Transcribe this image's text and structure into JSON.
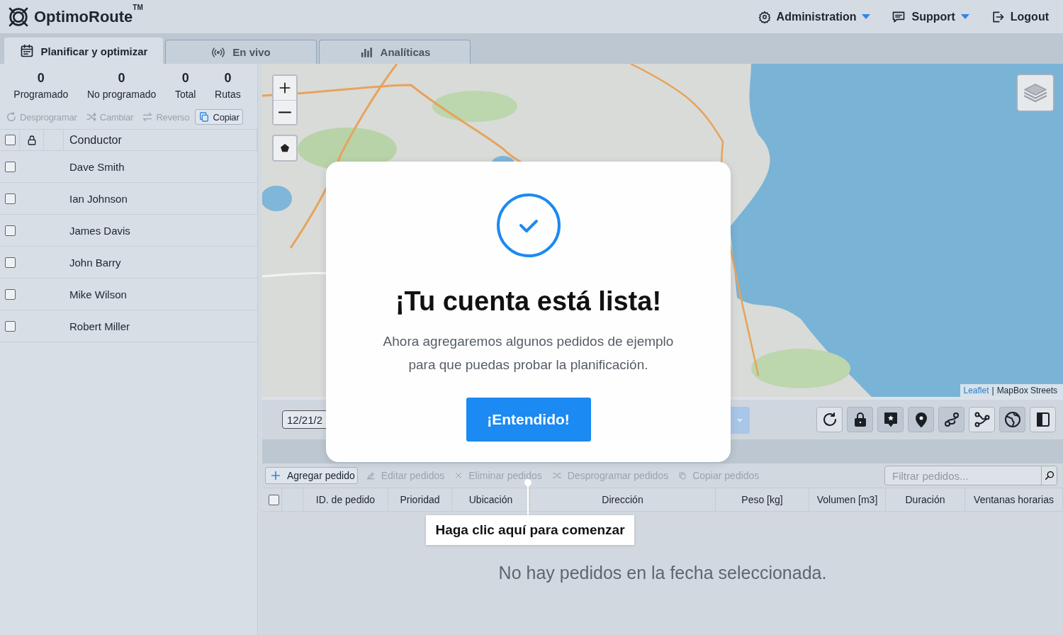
{
  "header": {
    "logo": "OptimoRoute",
    "trademark": "TM",
    "menu": [
      {
        "label": "Administration",
        "kind": "dropdown"
      },
      {
        "label": "Support",
        "kind": "dropdown"
      },
      {
        "label": "Logout",
        "kind": "link"
      }
    ]
  },
  "tabs": [
    {
      "label": "Planificar y optimizar",
      "selected": true
    },
    {
      "label": "En vivo",
      "selected": false
    },
    {
      "label": "Analíticas",
      "selected": false
    }
  ],
  "summary": [
    {
      "value": "0",
      "label": "Programado"
    },
    {
      "value": "0",
      "label": "No programado"
    },
    {
      "value": "0",
      "label": "Total"
    },
    {
      "value": "0",
      "label": "Rutas"
    }
  ],
  "route_actions": [
    {
      "label": "Desprogramar",
      "disabled": true
    },
    {
      "label": "Cambiar",
      "disabled": true
    },
    {
      "label": "Reverso",
      "disabled": true
    },
    {
      "label": "Copiar",
      "disabled": false
    }
  ],
  "drivers": {
    "select_all_checked": false,
    "column": "Conductor",
    "rows": [
      {
        "name": "Dave Smith",
        "checked": false
      },
      {
        "name": "Ian Johnson",
        "checked": false
      },
      {
        "name": "James Davis",
        "checked": false
      },
      {
        "name": "John Barry",
        "checked": false
      },
      {
        "name": "Mike Wilson",
        "checked": false
      },
      {
        "name": "Robert Miller",
        "checked": false
      }
    ]
  },
  "map": {
    "attribution_link": "Leaflet",
    "attribution_separator": "|",
    "attribution": "MapBox Streets"
  },
  "toolbar": {
    "date": "12/21/2",
    "buttons": [
      {
        "on": false
      },
      {
        "on": true
      },
      {
        "on": true
      },
      {
        "on": true
      },
      {
        "on": true
      },
      {
        "on": false
      },
      {
        "on": true
      },
      {
        "on": false
      }
    ]
  },
  "orders": {
    "select_all_checked": false,
    "actions": [
      {
        "label": "Agregar pedido",
        "disabled": false
      },
      {
        "label": "Editar pedidos",
        "disabled": true
      },
      {
        "label": "Eliminar pedidos",
        "disabled": true
      },
      {
        "label": "Desprogramar pedidos",
        "disabled": true
      },
      {
        "label": "Copiar pedidos",
        "disabled": true
      }
    ],
    "filter_placeholder": "Filtrar pedidos...",
    "columns": [
      "ID. de pedido",
      "Prioridad",
      "Ubicación",
      "Dirección",
      "Peso [kg]",
      "Volumen [m3]",
      "Duración",
      "Ventanas horarias"
    ],
    "empty_message": "No hay pedidos en la fecha seleccionada."
  },
  "dialog": {
    "title": "¡Tu cuenta está lista!",
    "message": "Ahora agregaremos algunos pedidos de ejemplo para que puedas probar la planificación.",
    "button": "¡Entendido!"
  },
  "hint": "Haga clic aquí para comenzar"
}
